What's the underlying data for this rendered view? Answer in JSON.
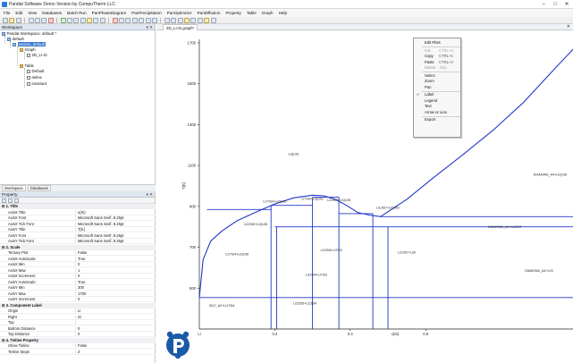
{
  "window": {
    "title": "Pandat Software Demo Version by CompuTherm LLC",
    "controls": [
      "–",
      "□",
      "✕"
    ]
  },
  "menu": [
    "File",
    "Edit",
    "View",
    "Databases",
    "Batch Run",
    "PanPhaseDiagram",
    "PanPrecipitation",
    "PanOptimizer",
    "PanDiffusion",
    "Property",
    "Table",
    "Graph",
    "Help"
  ],
  "workspace": {
    "header": "Workspace",
    "header_controls": "▾ ✕",
    "tree": [
      {
        "label": "Pandat Workspace: default *",
        "icon": "workspace-icon",
        "level": 0
      },
      {
        "label": "default",
        "icon": "project-icon",
        "level": 1
      },
      {
        "label": "section_default",
        "icon": "section-icon",
        "level": 2,
        "selected": true
      },
      {
        "label": "Graph",
        "icon": "folder-icon",
        "level": 3
      },
      {
        "label": "2D_LI-Si",
        "icon": "graph-icon",
        "level": 4
      },
      {
        "label": "Table",
        "icon": "folder-icon",
        "level": 3
      },
      {
        "label": "Default",
        "icon": "table-icon",
        "level": 4
      },
      {
        "label": "tieline",
        "icon": "table-icon",
        "level": 4
      },
      {
        "label": "invariant",
        "icon": "table-icon",
        "level": 4
      }
    ],
    "tabs": [
      "Workspace",
      "Databases"
    ]
  },
  "property": {
    "header": "Property",
    "header_controls": "▾ ✕",
    "rows": [
      {
        "k": "1. Title",
        "cat": true
      },
      {
        "k": "AxisX Title",
        "v": "x(Si)"
      },
      {
        "k": "AxisX Font",
        "v": "Microsoft Sans Serif, 8.25pt"
      },
      {
        "k": "AxisX Tick Font",
        "v": "Microsoft Sans Serif, 8.25pt"
      },
      {
        "k": "AxisY Title",
        "v": "T[K]"
      },
      {
        "k": "AxisY Font",
        "v": "Microsoft Sans Serif, 8.25pt"
      },
      {
        "k": "AxisY Tick Font",
        "v": "Microsoft Sans Serif, 8.25pt"
      },
      {
        "k": "2. Scale",
        "cat": true
      },
      {
        "k": "Ternary Plot",
        "v": "False"
      },
      {
        "k": "AxisX AutoScale",
        "v": "True"
      },
      {
        "k": "AxisX Min",
        "v": "0"
      },
      {
        "k": "AxisX Max",
        "v": "1"
      },
      {
        "k": "AxisX Increment",
        "v": "0"
      },
      {
        "k": "AxisY AutoScale",
        "v": "True"
      },
      {
        "k": "AxisY Min",
        "v": "300"
      },
      {
        "k": "AxisY Max",
        "v": "1700"
      },
      {
        "k": "AxisY Increment",
        "v": "0"
      },
      {
        "k": "3. Component Label",
        "cat": true
      },
      {
        "k": "Origin",
        "v": "Li"
      },
      {
        "k": "Right",
        "v": "Si"
      },
      {
        "k": "Top",
        "v": ""
      },
      {
        "k": "Bottom Distance",
        "v": "0"
      },
      {
        "k": "Top Distance",
        "v": "0"
      },
      {
        "k": "4. Tieline Property",
        "cat": true
      },
      {
        "k": "Show Tieline",
        "v": "False"
      },
      {
        "k": "Tieline Steps",
        "v": "2"
      }
    ]
  },
  "document": {
    "tab": "2D_LI-Si.graph*",
    "close": "✕"
  },
  "chart_data": {
    "type": "line",
    "xlabel": "x(Si)",
    "ylabel": "T[K]",
    "xlim": [
      0,
      1
    ],
    "ylim": [
      300,
      1700
    ],
    "yticks": [
      1700,
      1500,
      1300,
      1100,
      900,
      700,
      500
    ],
    "xticks": [
      0.2,
      0.4,
      0.6
    ],
    "x_origin_label": "Li",
    "grid": false,
    "phase_labels": [
      {
        "text": "LIQUID",
        "x": 0.25,
        "y": 1150
      },
      {
        "text": "DIAMOND_A4+LIQUID",
        "x": 0.93,
        "y": 1050
      },
      {
        "text": "Li17Si4+LIQUID",
        "x": 0.2,
        "y": 918
      },
      {
        "text": "Li7Si3+LIQUID",
        "x": 0.3,
        "y": 932
      },
      {
        "text": "Li13Si4+LIQUID",
        "x": 0.37,
        "y": 925
      },
      {
        "text": "Li12Si7+LIQUID",
        "x": 0.5,
        "y": 888
      },
      {
        "text": "Li22Si5+LIQUID",
        "x": 0.15,
        "y": 808
      },
      {
        "text": "DIAMOND_A4+Li12Si7",
        "x": 0.81,
        "y": 795
      },
      {
        "text": "Li17Si4+LIQUID",
        "x": 0.1,
        "y": 660
      },
      {
        "text": "Li13Si4+Li7Si3",
        "x": 0.35,
        "y": 680
      },
      {
        "text": "Li12Si7+LiSi",
        "x": 0.55,
        "y": 670
      },
      {
        "text": "DIAMOND_A4+LiSi",
        "x": 0.9,
        "y": 580
      },
      {
        "text": "Li13Si4+Li7Si3",
        "x": 0.31,
        "y": 560
      },
      {
        "text": "BCC_A2+Li17Si4",
        "x": 0.06,
        "y": 410
      },
      {
        "text": "Li22Si5+Li13Si4",
        "x": 0.28,
        "y": 420
      }
    ],
    "series": [
      {
        "type": "liquidus_left",
        "x": [
          0,
          0.01,
          0.03,
          0.06,
          0.1,
          0.15,
          0.2,
          0.25,
          0.3,
          0.33,
          0.36,
          0.39,
          0.42,
          0.45,
          0.48
        ],
        "y": [
          454,
          640,
          730,
          780,
          830,
          872,
          912,
          942,
          955,
          952,
          935,
          905,
          870,
          858,
          850
        ]
      },
      {
        "type": "liquidus_right",
        "x": [
          0.48,
          0.55,
          0.62,
          0.7,
          0.78,
          0.86,
          0.94,
          1.0
        ],
        "y": [
          850,
          935,
          1040,
          1155,
          1275,
          1410,
          1570,
          1687
        ]
      },
      {
        "type": "boundary",
        "x": [
          0.0,
          1.0
        ],
        "y": [
          454,
          454
        ]
      },
      {
        "type": "eutectic",
        "x": [
          0.02,
          0.19
        ],
        "y": [
          885,
          885
        ]
      },
      {
        "type": "eutectic",
        "x": [
          0.19,
          0.3
        ],
        "y": [
          905,
          905
        ]
      },
      {
        "type": "eutectic",
        "x": [
          0.3,
          0.37
        ],
        "y": [
          945,
          945
        ]
      },
      {
        "type": "eutectic",
        "x": [
          0.37,
          0.46
        ],
        "y": [
          865,
          865
        ]
      },
      {
        "type": "eutectic",
        "x": [
          0.48,
          1.0
        ],
        "y": [
          850,
          850
        ]
      },
      {
        "type": "eutectic",
        "x": [
          0.2,
          1.0
        ],
        "y": [
          800,
          800
        ]
      },
      {
        "type": "compound",
        "x": [
          0.19,
          0.19
        ],
        "y": [
          300,
          905
        ]
      },
      {
        "type": "compound",
        "x": [
          0.205,
          0.205
        ],
        "y": [
          300,
          800
        ]
      },
      {
        "type": "compound",
        "x": [
          0.3,
          0.3
        ],
        "y": [
          300,
          945
        ]
      },
      {
        "type": "compound",
        "x": [
          0.37,
          0.37
        ],
        "y": [
          300,
          945
        ]
      },
      {
        "type": "compound",
        "x": [
          0.46,
          0.46
        ],
        "y": [
          300,
          865
        ]
      },
      {
        "type": "compound",
        "x": [
          0.5,
          0.5
        ],
        "y": [
          300,
          800
        ]
      }
    ]
  },
  "context_menu": {
    "items": [
      {
        "label": "Edit Plots"
      },
      {
        "sep": true
      },
      {
        "label": "Cut",
        "shortcut": "CTRL+X",
        "disabled": true
      },
      {
        "label": "Copy",
        "shortcut": "CTRL+C"
      },
      {
        "label": "Paste",
        "shortcut": "CTRL+V"
      },
      {
        "label": "Delete",
        "shortcut": " DEL",
        "disabled": true
      },
      {
        "sep": true
      },
      {
        "label": "Select"
      },
      {
        "label": "Zoom"
      },
      {
        "label": "Pan"
      },
      {
        "sep": true
      },
      {
        "label": "Label",
        "checked": true
      },
      {
        "label": "Legend"
      },
      {
        "label": "Text"
      },
      {
        "label": "Arrow or Line"
      },
      {
        "sep": true
      },
      {
        "label": "Export"
      }
    ]
  },
  "colors": {
    "curve": "#2235c8",
    "accent": "#3a78d1",
    "logo": "#1a5aa8"
  }
}
